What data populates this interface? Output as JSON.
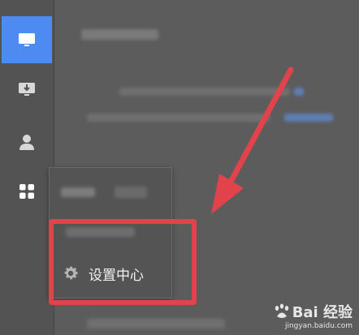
{
  "sidebar": {
    "items": [
      {
        "icon": "monitor-icon",
        "active": true
      },
      {
        "icon": "download-monitor-icon",
        "active": false
      },
      {
        "icon": "user-icon",
        "active": false
      },
      {
        "icon": "apps-grid-icon",
        "active": false
      }
    ]
  },
  "menu": {
    "settings_label": "设置中心"
  },
  "watermark": {
    "brand": "Bai 经验",
    "url": "jingyan.baidu.com"
  },
  "colors": {
    "accent": "#4d8bf3",
    "annotation": "#e0434b",
    "background": "#5c5c5c"
  }
}
